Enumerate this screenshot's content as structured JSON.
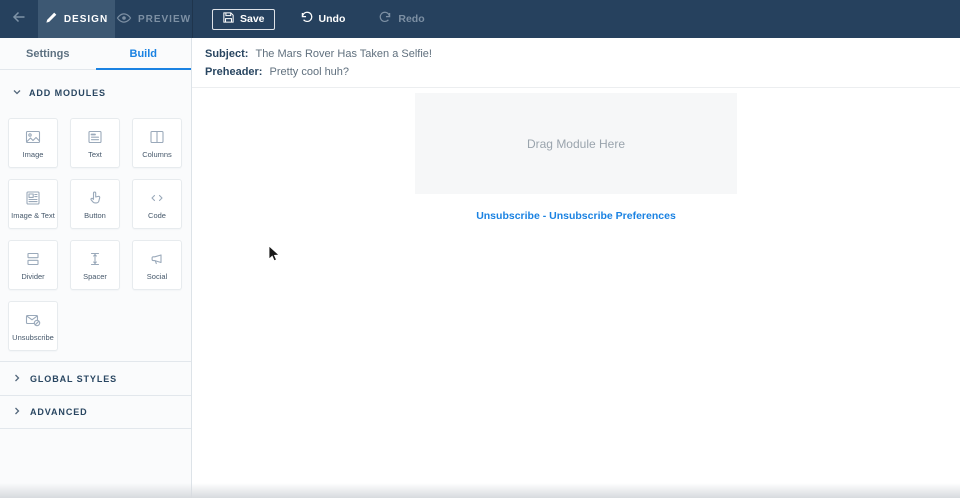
{
  "topbar": {
    "tabs": [
      {
        "label": "DESIGN",
        "active": true
      },
      {
        "label": "PREVIEW",
        "active": false
      }
    ],
    "save_label": "Save",
    "undo_label": "Undo",
    "redo_label": "Redo"
  },
  "sidebar": {
    "tabs": [
      {
        "label": "Settings",
        "active": false
      },
      {
        "label": "Build",
        "active": true
      }
    ],
    "add_modules_title": "ADD MODULES",
    "modules": [
      {
        "label": "Image",
        "icon": "image-icon"
      },
      {
        "label": "Text",
        "icon": "text-icon"
      },
      {
        "label": "Columns",
        "icon": "columns-icon"
      },
      {
        "label": "Image & Text",
        "icon": "image-text-icon"
      },
      {
        "label": "Button",
        "icon": "button-icon"
      },
      {
        "label": "Code",
        "icon": "code-icon"
      },
      {
        "label": "Divider",
        "icon": "divider-icon"
      },
      {
        "label": "Spacer",
        "icon": "spacer-icon"
      },
      {
        "label": "Social",
        "icon": "social-icon"
      },
      {
        "label": "Unsubscribe",
        "icon": "unsubscribe-icon"
      }
    ],
    "sections": [
      {
        "title": "GLOBAL STYLES"
      },
      {
        "title": "ADVANCED"
      }
    ]
  },
  "email_meta": {
    "subject_label": "Subject:",
    "subject_value": "The Mars Rover Has Taken a Selfie!",
    "preheader_label": "Preheader:",
    "preheader_value": "Pretty cool huh?"
  },
  "canvas": {
    "dropzone_text": "Drag Module Here",
    "unsubscribe_link": "Unsubscribe",
    "link_separator": " - ",
    "preferences_link": "Unsubscribe Preferences"
  },
  "colors": {
    "topbar_bg": "#26415e",
    "topbar_active": "#3d5873",
    "accent": "#1a82e2",
    "slate": "#294661",
    "dropzone_bg": "#f6f7f8"
  }
}
